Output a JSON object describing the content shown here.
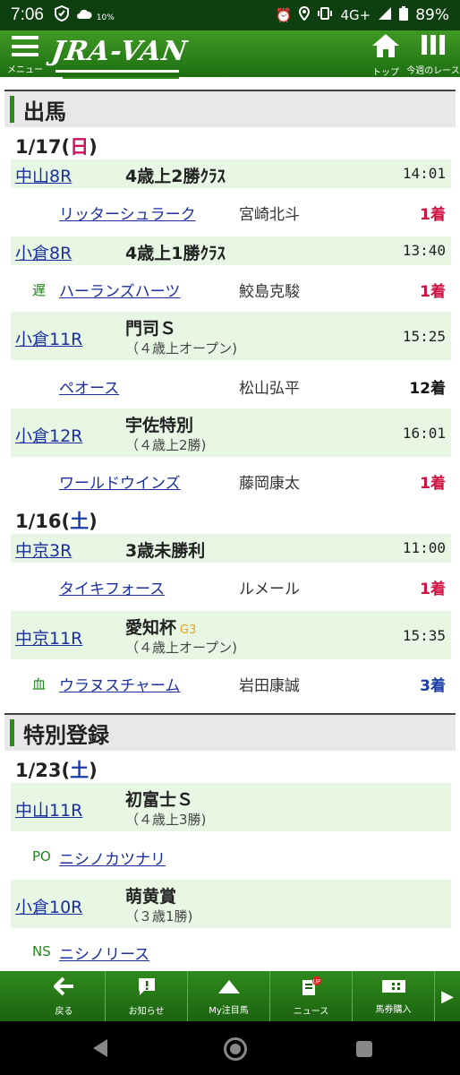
{
  "status_bar": {
    "time": "7:06",
    "network": "4G+",
    "battery": "89%",
    "speed": "10%"
  },
  "header": {
    "menu_label": "メニュー",
    "logo": "JRA-VAN",
    "top_label": "トップ",
    "week_label": "今週のレース"
  },
  "sections": {
    "entries": {
      "title": "出馬",
      "dates": [
        {
          "date_num": "1/17",
          "day": "日"
        },
        {
          "date_num": "1/16",
          "day": "土"
        }
      ],
      "races": [
        {
          "race": "中山8R",
          "title": "4歳上2勝ｸﾗｽ",
          "sub": "",
          "time": "14:01",
          "mark": "",
          "horse": "リッターシュラーク",
          "jockey": "宮崎北斗",
          "result": "1着"
        },
        {
          "race": "小倉8R",
          "title": "4歳上1勝ｸﾗｽ",
          "sub": "",
          "time": "13:40",
          "mark": "遅",
          "horse": "ハーランズハーツ",
          "jockey": "鮫島克駿",
          "result": "1着"
        },
        {
          "race": "小倉11R",
          "title": "門司Ｓ",
          "sub": "（４歳上オープン)",
          "time": "15:25",
          "mark": "",
          "horse": "ペオース",
          "jockey": "松山弘平",
          "result": "12着"
        },
        {
          "race": "小倉12R",
          "title": "宇佐特別",
          "sub": "（４歳上2勝)",
          "time": "16:01",
          "mark": "",
          "horse": "ワールドウインズ",
          "jockey": "藤岡康太",
          "result": "1着"
        },
        {
          "race": "中京3R",
          "title": "3歳未勝利",
          "sub": "",
          "time": "11:00",
          "mark": "",
          "horse": "タイキフォース",
          "jockey": "ルメール",
          "result": "1着"
        },
        {
          "race": "中京11R",
          "title": "愛知杯",
          "grade": "G3",
          "sub": "（４歳上オープン)",
          "time": "15:35",
          "mark": "血",
          "horse": "ウラヌスチャーム",
          "jockey": "岩田康誠",
          "result": "3着"
        }
      ]
    },
    "special": {
      "title": "特別登録",
      "date": {
        "date_num": "1/23",
        "day": "土"
      },
      "races": [
        {
          "race": "中山11R",
          "title": "初富士Ｓ",
          "sub": "（４歳上3勝)",
          "mark": "PO",
          "horse": "ニシノカツナリ"
        },
        {
          "race": "小倉10R",
          "title": "萌黄賞",
          "sub": "（３歳1勝)",
          "mark": "NS",
          "horse": "ニシノリース"
        }
      ]
    }
  },
  "bottom_nav": [
    "戻る",
    "お知らせ",
    "My注目馬",
    "ニュース",
    "馬券購入"
  ],
  "colors": {
    "header_green": "#2f8a1c",
    "row_green": "#e7f7e4",
    "link_blue": "#1a2fa0",
    "first_red": "#d01040"
  }
}
